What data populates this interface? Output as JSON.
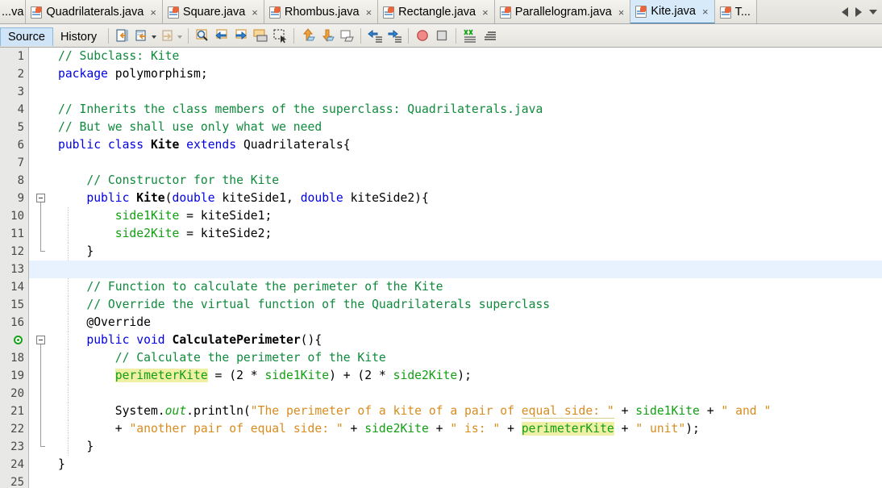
{
  "window": {
    "app": "NetBeans IDE Java Editor"
  },
  "tabbar": {
    "tabs": [
      {
        "label": "...va",
        "clipped": true,
        "active": false,
        "closable": false,
        "icon": "java-file-icon"
      },
      {
        "label": "Quadrilaterals.java",
        "clipped": false,
        "active": false,
        "closable": true,
        "icon": "java-file-icon"
      },
      {
        "label": "Square.java",
        "clipped": false,
        "active": false,
        "closable": true,
        "icon": "java-file-icon"
      },
      {
        "label": "Rhombus.java",
        "clipped": false,
        "active": false,
        "closable": true,
        "icon": "java-file-icon"
      },
      {
        "label": "Rectangle.java",
        "clipped": false,
        "active": false,
        "closable": true,
        "icon": "java-file-icon"
      },
      {
        "label": "Parallelogram.java",
        "clipped": false,
        "active": false,
        "closable": true,
        "icon": "java-file-icon"
      },
      {
        "label": "Kite.java",
        "clipped": false,
        "active": true,
        "closable": true,
        "icon": "java-file-icon"
      },
      {
        "label": "T...",
        "clipped": false,
        "active": false,
        "closable": false,
        "icon": "java-file-icon"
      }
    ],
    "close_glyph": "×",
    "nav": {
      "prev": "scroll-tabs-left",
      "next": "scroll-tabs-right",
      "list": "tab-list-dropdown"
    }
  },
  "toolbar": {
    "view_tabs": [
      {
        "label": "Source",
        "selected": true
      },
      {
        "label": "History",
        "selected": false
      }
    ],
    "buttons": [
      {
        "name": "last-edit-button",
        "title": "Last Edit"
      },
      {
        "name": "back-navigation-button",
        "title": "Back"
      },
      {
        "name": "forward-navigation-button",
        "title": "Forward"
      },
      {
        "name": "find-selection-button",
        "title": "Find Selection"
      },
      {
        "name": "find-previous-button",
        "title": "Find Previous"
      },
      {
        "name": "find-next-button",
        "title": "Find Next"
      },
      {
        "name": "toggle-highlight-button",
        "title": "Toggle Highlight Search"
      },
      {
        "name": "toggle-rectangular-selection-button",
        "title": "Rectangular Selection"
      },
      {
        "name": "previous-bookmark-button",
        "title": "Previous Bookmark"
      },
      {
        "name": "next-bookmark-button",
        "title": "Next Bookmark"
      },
      {
        "name": "toggle-bookmark-button",
        "title": "Toggle Bookmark"
      },
      {
        "name": "shift-left-button",
        "title": "Shift Line Left"
      },
      {
        "name": "shift-right-button",
        "title": "Shift Line Right"
      },
      {
        "name": "start-macro-recording-button",
        "title": "Start Macro Recording"
      },
      {
        "name": "stop-macro-recording-button",
        "title": "Stop Macro Recording"
      },
      {
        "name": "comment-button",
        "title": "Comment"
      },
      {
        "name": "uncomment-button",
        "title": "Uncomment"
      }
    ]
  },
  "editor": {
    "caret_line": 13,
    "lines": [
      {
        "num": "1",
        "fold": "none",
        "indent": false,
        "tokens": [
          {
            "t": "// Subclass: Kite",
            "c": "cmt"
          }
        ]
      },
      {
        "num": "2",
        "fold": "none",
        "indent": false,
        "tokens": [
          {
            "t": "package",
            "c": "kw"
          },
          {
            "t": " polymorphism;",
            "c": ""
          }
        ]
      },
      {
        "num": "3",
        "fold": "none",
        "indent": false,
        "tokens": []
      },
      {
        "num": "4",
        "fold": "none",
        "indent": false,
        "tokens": [
          {
            "t": "// Inherits the class members of the superclass: Quadrilaterals.java",
            "c": "cmt"
          }
        ]
      },
      {
        "num": "5",
        "fold": "none",
        "indent": false,
        "tokens": [
          {
            "t": "// But we shall use only what we need",
            "c": "cmt"
          }
        ]
      },
      {
        "num": "6",
        "fold": "none",
        "indent": false,
        "tokens": [
          {
            "t": "public class ",
            "c": "kw"
          },
          {
            "t": "Kite",
            "c": "bld"
          },
          {
            "t": " extends ",
            "c": "kw"
          },
          {
            "t": "Quadrilaterals{",
            "c": ""
          }
        ]
      },
      {
        "num": "7",
        "fold": "none",
        "indent": false,
        "tokens": []
      },
      {
        "num": "8",
        "fold": "none",
        "indent": false,
        "tokens": [
          {
            "t": "    // Constructor for the Kite",
            "c": "cmt"
          }
        ]
      },
      {
        "num": "9",
        "fold": "box",
        "indent": false,
        "tokens": [
          {
            "t": "    ",
            "c": ""
          },
          {
            "t": "public ",
            "c": "kw"
          },
          {
            "t": "Kite",
            "c": "bld"
          },
          {
            "t": "(",
            "c": ""
          },
          {
            "t": "double",
            "c": "kw"
          },
          {
            "t": " kiteSide1, ",
            "c": ""
          },
          {
            "t": "double",
            "c": "kw"
          },
          {
            "t": " kiteSide2){",
            "c": ""
          }
        ]
      },
      {
        "num": "10",
        "fold": "line",
        "indent": true,
        "tokens": [
          {
            "t": "        ",
            "c": ""
          },
          {
            "t": "side1Kite",
            "c": "fld"
          },
          {
            "t": " = kiteSide1;",
            "c": ""
          }
        ]
      },
      {
        "num": "11",
        "fold": "line",
        "indent": true,
        "tokens": [
          {
            "t": "        ",
            "c": ""
          },
          {
            "t": "side2Kite",
            "c": "fld"
          },
          {
            "t": " = kiteSide2;",
            "c": ""
          }
        ]
      },
      {
        "num": "12",
        "fold": "end",
        "indent": true,
        "tokens": [
          {
            "t": "    }",
            "c": ""
          }
        ]
      },
      {
        "num": "13",
        "fold": "none",
        "indent": false,
        "tokens": []
      },
      {
        "num": "14",
        "fold": "none",
        "indent": true,
        "tokens": [
          {
            "t": "    // Function to calculate the perimeter of the Kite",
            "c": "cmt"
          }
        ]
      },
      {
        "num": "15",
        "fold": "none",
        "indent": true,
        "tokens": [
          {
            "t": "    // Override the virtual function of the Quadrilaterals superclass",
            "c": "cmt"
          }
        ]
      },
      {
        "num": "16",
        "fold": "none",
        "indent": true,
        "tokens": [
          {
            "t": "    @Override",
            "c": ""
          }
        ]
      },
      {
        "num": "17",
        "fold": "box",
        "indent": true,
        "glyph": "override-annotation-glyph",
        "tokens": [
          {
            "t": "    ",
            "c": ""
          },
          {
            "t": "public void ",
            "c": "kw"
          },
          {
            "t": "CalculatePerimeter",
            "c": "bld"
          },
          {
            "t": "(){",
            "c": ""
          }
        ]
      },
      {
        "num": "18",
        "fold": "line",
        "indent": true,
        "tokens": [
          {
            "t": "        // Calculate the perimeter of the Kite",
            "c": "cmt"
          }
        ]
      },
      {
        "num": "19",
        "fold": "line",
        "indent": true,
        "tokens": [
          {
            "t": "        ",
            "c": ""
          },
          {
            "t": "perimeterKite",
            "c": "fld hl"
          },
          {
            "t": " = (",
            "c": ""
          },
          {
            "t": "2",
            "c": ""
          },
          {
            "t": " * ",
            "c": ""
          },
          {
            "t": "side1Kite",
            "c": "fld"
          },
          {
            "t": ") + (",
            "c": ""
          },
          {
            "t": "2",
            "c": ""
          },
          {
            "t": " * ",
            "c": ""
          },
          {
            "t": "side2Kite",
            "c": "fld"
          },
          {
            "t": ");",
            "c": ""
          }
        ]
      },
      {
        "num": "20",
        "fold": "line",
        "indent": true,
        "tokens": []
      },
      {
        "num": "21",
        "fold": "line",
        "indent": true,
        "tokens": [
          {
            "t": "        System.",
            "c": ""
          },
          {
            "t": "out",
            "c": "fldi"
          },
          {
            "t": ".println(",
            "c": ""
          },
          {
            "t": "\"The perimeter of a kite of a pair of ",
            "c": "str"
          },
          {
            "t": "equal side: \"",
            "c": "str ulstr"
          },
          {
            "t": " + ",
            "c": ""
          },
          {
            "t": "side1Kite",
            "c": "fld"
          },
          {
            "t": " + ",
            "c": ""
          },
          {
            "t": "\" and \"",
            "c": "str"
          }
        ]
      },
      {
        "num": "22",
        "fold": "line",
        "indent": true,
        "tokens": [
          {
            "t": "        + ",
            "c": ""
          },
          {
            "t": "\"another pair of equal side: \"",
            "c": "str"
          },
          {
            "t": " + ",
            "c": ""
          },
          {
            "t": "side2Kite",
            "c": "fld"
          },
          {
            "t": " + ",
            "c": ""
          },
          {
            "t": "\" is: \"",
            "c": "str"
          },
          {
            "t": " + ",
            "c": ""
          },
          {
            "t": "perimeterKite",
            "c": "fld hl"
          },
          {
            "t": " + ",
            "c": ""
          },
          {
            "t": "\" unit\"",
            "c": "str"
          },
          {
            "t": ");",
            "c": ""
          }
        ]
      },
      {
        "num": "23",
        "fold": "end",
        "indent": true,
        "tokens": [
          {
            "t": "    }",
            "c": ""
          }
        ]
      },
      {
        "num": "24",
        "fold": "none",
        "indent": false,
        "tokens": [
          {
            "t": "}",
            "c": ""
          }
        ]
      },
      {
        "num": "25",
        "fold": "none",
        "indent": false,
        "tokens": []
      }
    ]
  },
  "colors": {
    "comment": "#0f8a3c",
    "keyword": "#0000e6",
    "string": "#d88c1e",
    "field": "#12a012",
    "highlight": "#efefa6",
    "caret_line": "#e8f2fe",
    "gutter_bg": "#e8e8e6",
    "active_tab_bg": "#d6eaf9"
  }
}
